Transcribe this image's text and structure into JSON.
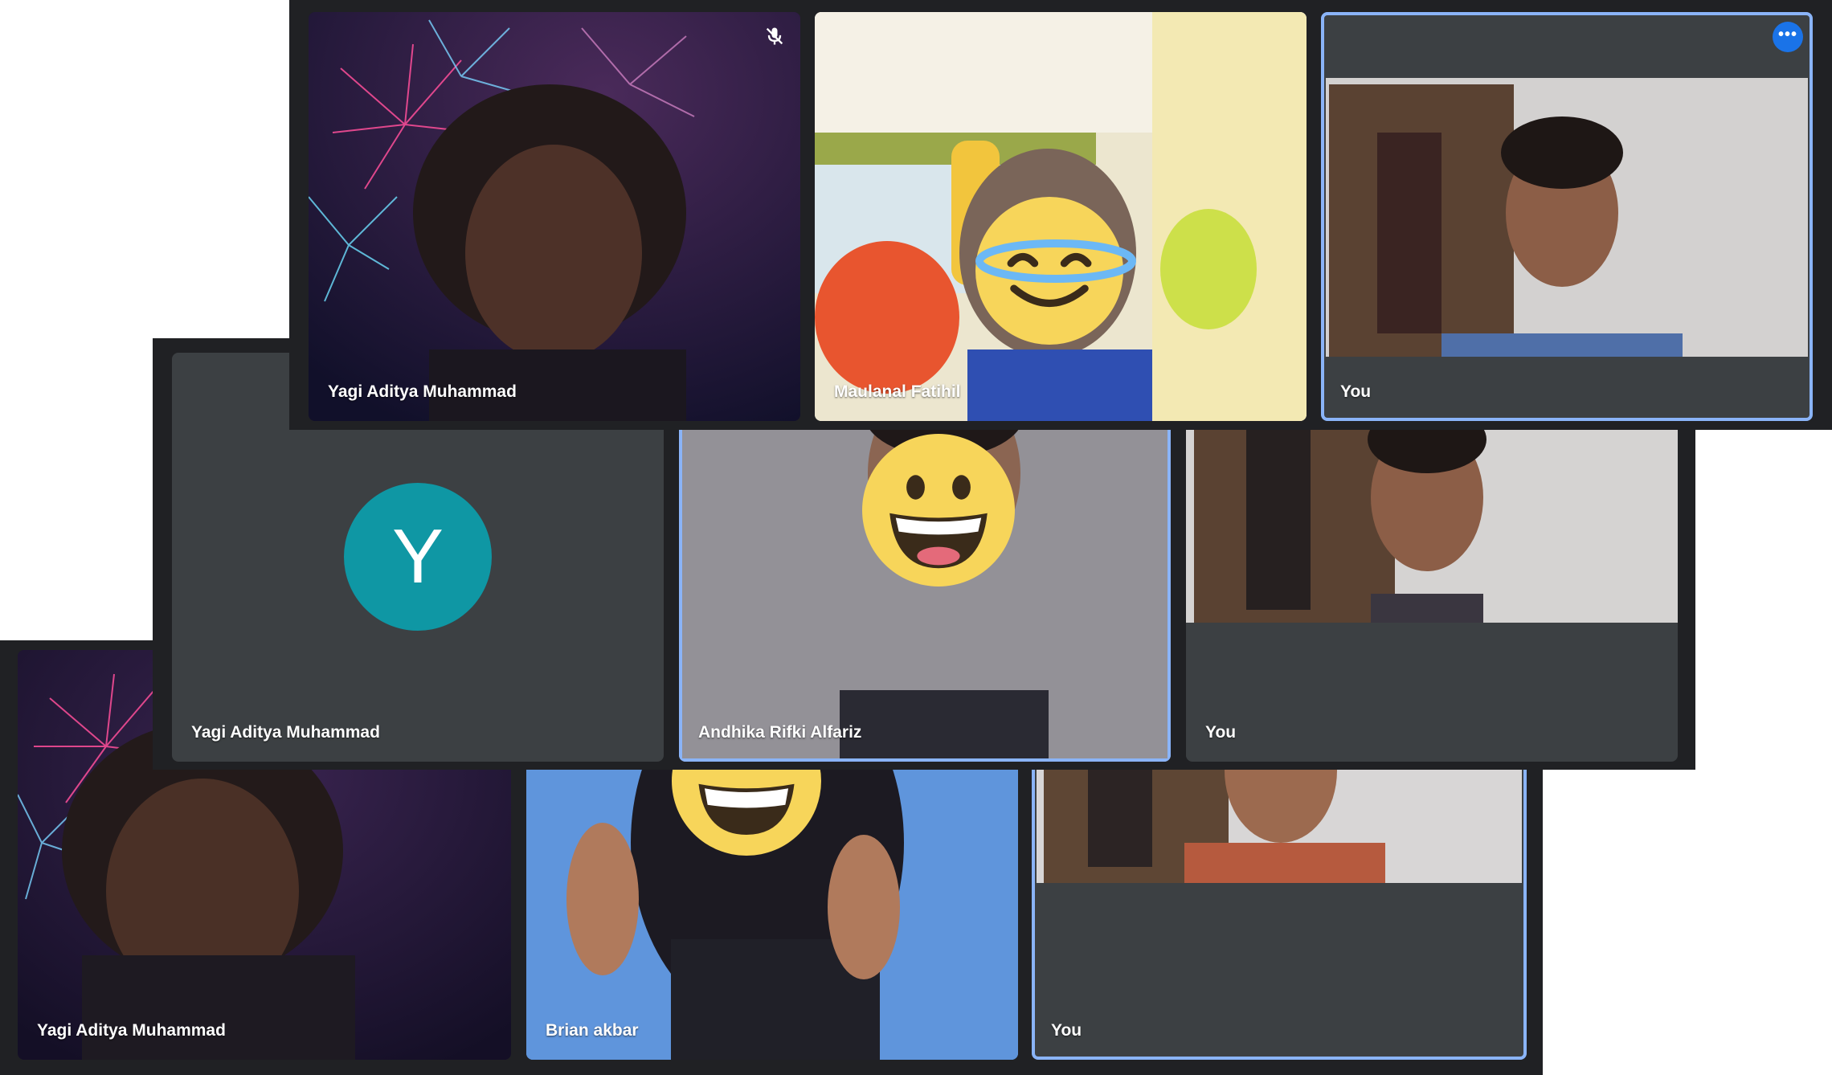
{
  "screenshots": [
    {
      "tiles": [
        {
          "name": "Yagi Aditya Muhammad",
          "muted": true
        },
        {
          "name": "Maulanal Fatihil"
        },
        {
          "name": "You",
          "menu_button": "more-options"
        }
      ]
    },
    {
      "tiles": [
        {
          "name": "Yagi Aditya Muhammad",
          "avatar_letter": "Y"
        },
        {
          "name": "Andhika Rifki Alfariz"
        },
        {
          "name": "You"
        }
      ]
    },
    {
      "tiles": [
        {
          "name": "Yagi Aditya Muhammad"
        },
        {
          "name": "Brian akbar"
        },
        {
          "name": "You"
        }
      ]
    }
  ],
  "colors": {
    "panel": "#202124",
    "tile": "#3c4043",
    "active_border": "#8ab4f8",
    "avatar": "#0f97a4",
    "menu_button": "#1a73e8"
  }
}
